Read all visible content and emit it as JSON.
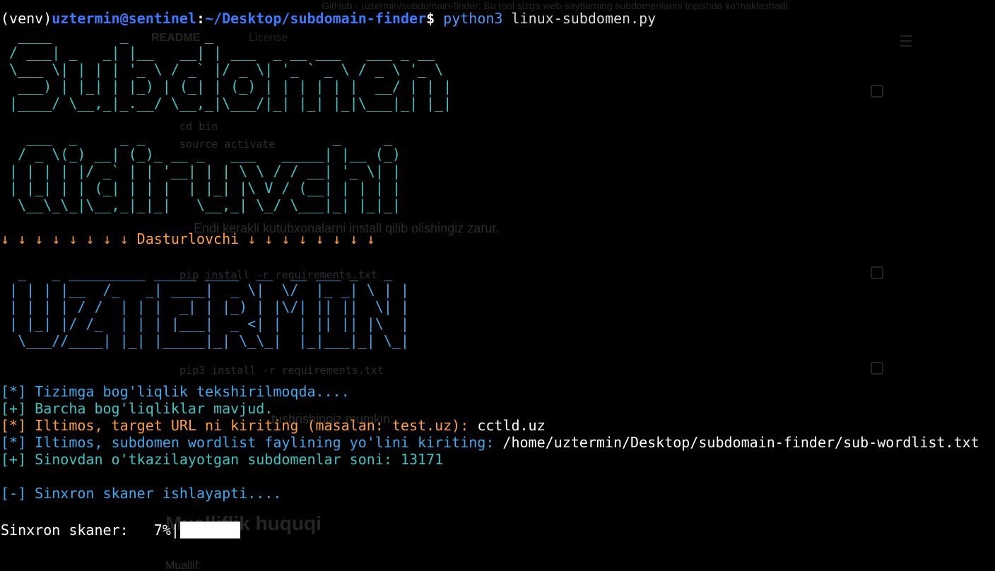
{
  "background_page": {
    "window_title": "GitHub - uztermin/subdomain-finder: Bu tool sizga web-saytlarning subdomenlarini topishda ko'maklashadi.",
    "tab_readme": "README",
    "tab_license": "License",
    "code_lines": [
      "cd bin",
      "source activate"
    ],
    "code_cd": "cd bin",
    "code_source": "source activate",
    "bullet_text": "Endi kerakli kutubxonalarni install qilib olishingiz zarur.",
    "code_pip": "pip install -r requirements.txt",
    "code_pip3": "pip3 install -r requirements.txt",
    "text_mumkin": "tushrishingiz mumkin:",
    "heading_copyright": "Mualliflik huquqi",
    "author_label": "Muallif:"
  },
  "terminal": {
    "prompt": {
      "venv": "(venv)",
      "user_host": "uztermin@sentinel",
      "colon": ":",
      "path": "~/Desktop/subdomain-finder",
      "dollar": "$ ",
      "cmd_bin": "python3",
      "cmd_arg": "linux-subdomen.py"
    },
    "banner_subdomen": [
      "  ____        _         _                            ",
      " / ___| _   _| |__   __| | ___  _ __ ___   ___ _ __  ",
      " \\___ \\| | | | '_ \\ / _` |/ _ \\| '_ ` _ \\ / _ \\ '_ \\ ",
      "  ___) | |_| | |_) | (_| | (_) | | | | | |  __/ | | |",
      " |____/ \\__,_|_.__/ \\__,_|\\___/|_| |_| |_|\\___|_| |_|"
    ],
    "banner_qidiruvchi": [
      "   ___  _     _ _                      _     _ ",
      "  / _ \\(_) __| (_)_ __ _   ___   _____| |__ (_)",
      " | | | | |/ _` | | '__| | | \\ \\ / / __| '_ \\| |",
      " | |_| | | (_| | | |  | |_| |\\ V / (__| | | | |",
      "  \\__\\_\\_|\\__,_|_|_|   \\__,_| \\_/ \\___|_| |_|_|"
    ],
    "developer_line": "↓ ↓ ↓ ↓ ↓ ↓ ↓ ↓ Dasturlovchi ↓ ↓ ↓ ↓ ↓ ↓ ↓ ↓",
    "banner_uztermin": [
      "  _   _ _________ _____ ____  __  __ ___ _   _ ",
      " | | | |__  /_   _| ____|  _ \\|  \\/  |_ _| \\ | |",
      " | | | | / /  | | |  _| | |_) | |\\/| || ||  \\| |",
      " | |_| |/ /_  | | | |___|  _ <| |  | || || |\\  |",
      "  \\___//____| |_| |_____|_| \\_\\_|  |_|___|_| \\_|"
    ],
    "messages": {
      "check_prefix": "[*]",
      "check_text": " Tizimga bog'liqlik tekshirilmoqda....",
      "ok_prefix": "[+]",
      "ok_text": " Barcha bog'liqliklar mavjud.",
      "target_prefix": "[*]",
      "target_prompt": " Iltimos, target URL ni kiriting (masalan: test.uz): ",
      "target_value": "cctld.uz",
      "wordlist_prefix": "[*]",
      "wordlist_prompt": " Iltimos, subdomen wordlist faylining yo'lini kiriting: ",
      "wordlist_value": "/home/uztermin/Desktop/subdomain-finder/sub-wordlist.txt",
      "count_prefix": "[+]",
      "count_text": " Sinovdan o'tkazilayotgan subdomenlar soni: 13171",
      "scan_prefix": "[-]",
      "scan_text": " Sinxron skaner ishlayapti...."
    },
    "progress": {
      "label": "Sinxron skaner:   7%|",
      "percent": 7
    }
  },
  "colors": {
    "background": "#000000",
    "prompt_blue": "#3c7bff",
    "banner_cyan": "#3fc4c4",
    "banner_blue": "#42a6e8",
    "orange": "#ff9f3f"
  }
}
